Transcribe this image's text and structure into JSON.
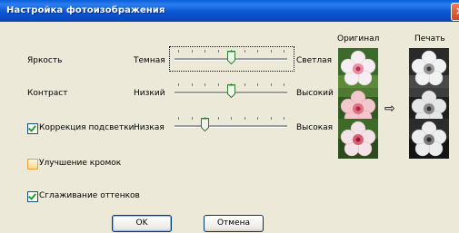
{
  "window": {
    "title": "Настройка фотоизображения",
    "close_glyph": "×"
  },
  "rows": {
    "brightness": {
      "label": "Яркость",
      "min_label": "Темная",
      "max_label": "Светлая",
      "level": 0.5
    },
    "contrast": {
      "label": "Контраст",
      "min_label": "Низкий",
      "max_label": "Высокий",
      "level": 0.5
    },
    "backlight": {
      "label": "Коррекция подсветки",
      "checked": true,
      "min_label": "Низкая",
      "max_label": "Высокая",
      "level": 0.25
    }
  },
  "options": {
    "edge_enhance": {
      "label": "Улучшение кромок",
      "checked": false
    },
    "smoothing": {
      "label": "Сглаживание оттенков",
      "checked": true
    }
  },
  "preview": {
    "original_label": "Оригинал",
    "print_label": "Печать",
    "arrow_glyph": "⇨"
  },
  "buttons": {
    "ok": "OK",
    "cancel": "Отмена"
  },
  "colors": {
    "titlebar": "#0b57d3",
    "face": "#ece9d8",
    "button_border": "#003c74"
  }
}
